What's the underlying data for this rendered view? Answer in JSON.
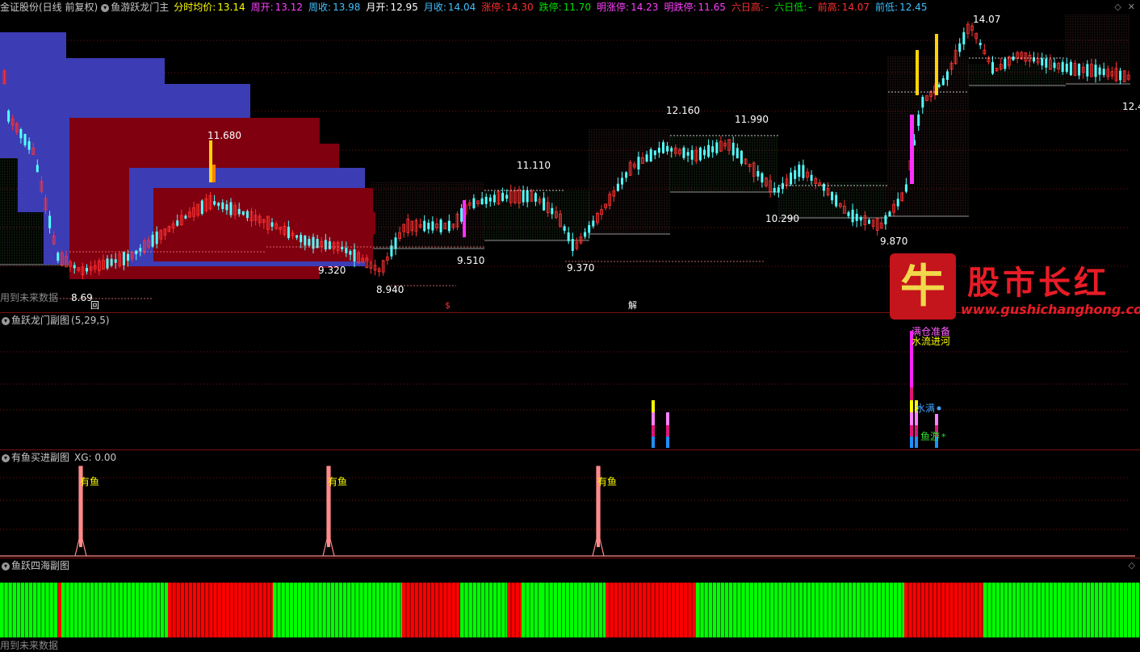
{
  "main_header": {
    "stock": "金证股份(日线 前复权)",
    "indicator": "鱼游跃龙门主",
    "fields": [
      {
        "label": "分时均价:",
        "value": "13.14",
        "color": "#ffff00"
      },
      {
        "label": "周开:",
        "value": "13.12",
        "color": "#ff40ff"
      },
      {
        "label": "周收:",
        "value": "13.98",
        "color": "#40c0ff"
      },
      {
        "label": "月开:",
        "value": "12.95",
        "color": "#ffffff"
      },
      {
        "label": "月收:",
        "value": "14.04",
        "color": "#40c0ff"
      },
      {
        "label": "涨停:",
        "value": "14.30",
        "color": "#ff3030"
      },
      {
        "label": "跌停:",
        "value": "11.70",
        "color": "#00e000"
      },
      {
        "label": "明涨停:",
        "value": "14.23",
        "color": "#ff40ff"
      },
      {
        "label": "明跌停:",
        "value": "11.65",
        "color": "#ff40ff"
      },
      {
        "label": "六日高:",
        "value": "-",
        "color": "#ff3030"
      },
      {
        "label": "六日低:",
        "value": "-",
        "color": "#00e000"
      },
      {
        "label": "前高:",
        "value": "14.07",
        "color": "#ff3030"
      },
      {
        "label": "前低:",
        "value": "12.45",
        "color": "#40c0ff"
      }
    ]
  },
  "main_chart": {
    "price_labels": [
      "14.07",
      "12.160",
      "11.990",
      "11.680",
      "11.110",
      "10.290",
      "9.870",
      "9.510",
      "9.370",
      "9.320",
      "8.940",
      "8.69",
      "12.4"
    ],
    "future_note": "用到未来数据",
    "markers": [
      "回",
      "$",
      "解"
    ]
  },
  "sub1": {
    "title": "鱼跃龙门副图",
    "params": "(5,29,5)",
    "labels": [
      "满仓准备",
      "水流进河",
      "水满",
      "鱼游"
    ]
  },
  "sub2": {
    "title": "有鱼买进副图",
    "xg": "XG: 0.00",
    "signal_label": "有鱼"
  },
  "sub3": {
    "title": "鱼跃四海副图",
    "future_note": "用到未来数据"
  },
  "watermark": {
    "mark": "牛",
    "title": "股市长红",
    "url": "www.gushichanghong.com"
  },
  "colors": {
    "up": "#ff3232",
    "down": "#54ffff",
    "panel_sep": "#7a1010",
    "green_bar": "#00ff00",
    "red_bar": "#ff0000"
  }
}
